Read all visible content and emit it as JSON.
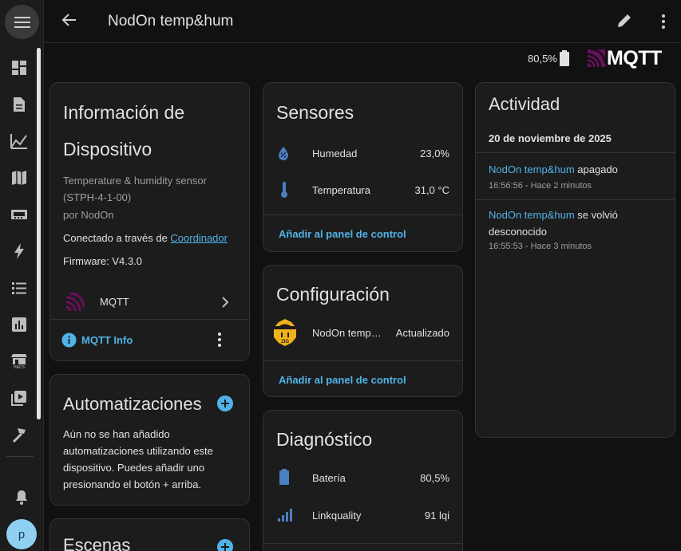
{
  "header": {
    "title": "NodOn temp&hum"
  },
  "device_status": {
    "battery": "80,5%"
  },
  "brand": {
    "mqtt_logo_text": "MQTT"
  },
  "sidebar": {
    "items": [
      "dashboard",
      "logbook",
      "history",
      "map",
      "energy",
      "automations",
      "todo",
      "statistics",
      "hacs",
      "media",
      "developer-tools"
    ],
    "hacs_label": "HACS",
    "avatar_initial": "p"
  },
  "device_info": {
    "title_line1": "Información de",
    "title_line2": "Dispositivo",
    "model": "Temperature & humidity sensor",
    "model_id": "(STPH-4-1-00)",
    "manufacturer": "por NodOn",
    "connected_prefix": "Conectado a través de ",
    "connected_link": "Coordinador",
    "firmware": "Firmware: V4.3.0",
    "integration_name": "MQTT",
    "mqtt_info_label": "MQTT Info"
  },
  "automations": {
    "title": "Automatizaciones",
    "body": "Aún no se han añadido automatizaciones utilizando este dispositivo. Puedes añadir uno presionando el botón + arriba."
  },
  "scenes": {
    "title": "Escenas"
  },
  "sensors": {
    "title": "Sensores",
    "rows": [
      {
        "label": "Humedad",
        "value": "23,0%"
      },
      {
        "label": "Temperatura",
        "value": "31,0 °C"
      }
    ],
    "add_label": "Añadir al panel de control"
  },
  "configuration": {
    "title": "Configuración",
    "row_label": "NodOn temp…",
    "row_value": "Actualizado",
    "add_label": "Añadir al panel de control"
  },
  "diagnostics": {
    "title": "Diagnóstico",
    "rows": [
      {
        "label": "Batería",
        "value": "80,5%"
      },
      {
        "label": "Linkquality",
        "value": "91 lqi"
      }
    ]
  },
  "activity": {
    "title": "Actividad",
    "date": "20 de noviembre de 2025",
    "events": [
      {
        "entity": "NodOn temp&hum",
        "text": " apagado",
        "time": "16:56:56 - Hace 2 minutos"
      },
      {
        "entity": "NodOn temp&hum",
        "text": " se volvió desconocido",
        "time": "16:55:53 - Hace 3 minutos"
      }
    ]
  },
  "colors": {
    "accent": "#4fb3e8",
    "mqtt_purple": "#6a0f5e",
    "card_bg": "#1c1c1c",
    "bg": "#111111"
  }
}
